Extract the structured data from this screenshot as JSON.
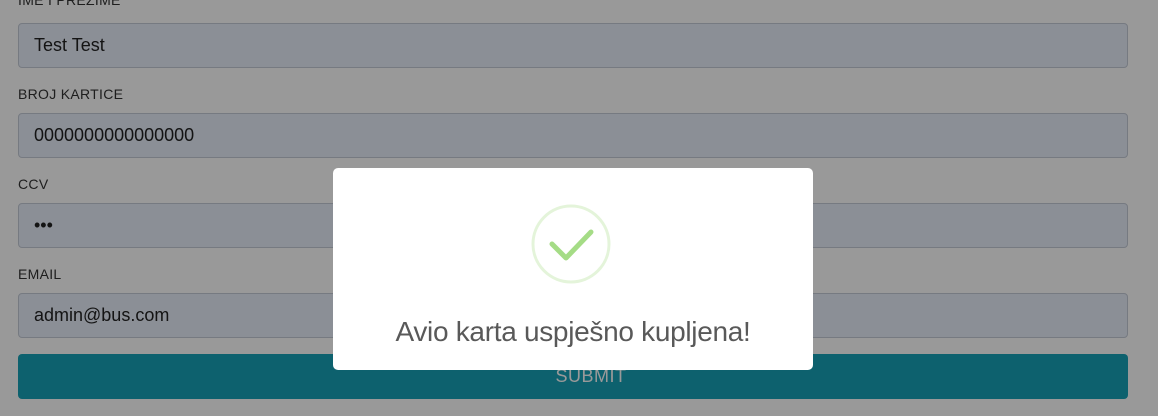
{
  "form": {
    "fields": [
      {
        "label": "IME I PREZIME",
        "value": "Test Test"
      },
      {
        "label": "BROJ KARTICE",
        "value": "0000000000000000"
      },
      {
        "label": "CCV",
        "value": "•••"
      },
      {
        "label": "EMAIL",
        "value": "admin@bus.com"
      }
    ],
    "submit_label": "SUBMIT"
  },
  "modal": {
    "icon": "success-check-icon",
    "title": "Avio karta uspješno kupljena!",
    "icon_color": "#a5dc86"
  },
  "colors": {
    "submit_button": "#17a2b8",
    "input_background": "#e8eefb"
  }
}
